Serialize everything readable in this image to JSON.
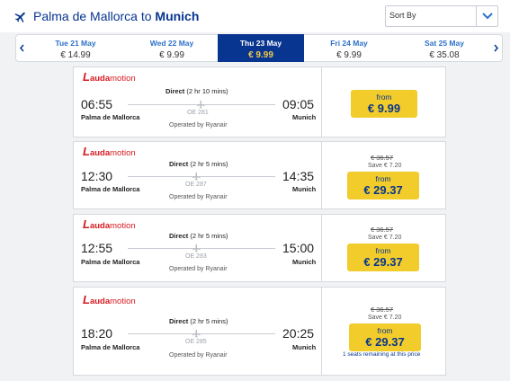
{
  "header": {
    "origin_text": "Palma de Mallorca to ",
    "destination_text": "Munich",
    "sort_label": "Sort By"
  },
  "dates": [
    {
      "day": "Tue 21 May",
      "price": "€ 14.99",
      "active": false
    },
    {
      "day": "Wed 22 May",
      "price": "€ 9.99",
      "active": false
    },
    {
      "day": "Thu 23 May",
      "price": "€ 9.99",
      "active": true
    },
    {
      "day": "Fri 24 May",
      "price": "€ 9.99",
      "active": false
    },
    {
      "day": "Sat 25 May",
      "price": "€ 35.08",
      "active": false
    }
  ],
  "flights": [
    {
      "airline_mark": "L",
      "airline_bold": "auda",
      "airline_rest": "motion",
      "dep_time": "06:55",
      "arr_time": "09:05",
      "dep_airport": "Palma de Mallorca",
      "arr_airport": "Munich",
      "direct_label": "Direct",
      "duration": "(2 hr 10 mins)",
      "flight_no": "OE 281",
      "operated": "Operated by Ryanair",
      "old_price": "",
      "save": "",
      "from": "from",
      "price": "€ 9.99",
      "seats": ""
    },
    {
      "airline_mark": "L",
      "airline_bold": "auda",
      "airline_rest": "motion",
      "dep_time": "12:30",
      "arr_time": "14:35",
      "dep_airport": "Palma de Mallorca",
      "arr_airport": "Munich",
      "direct_label": "Direct",
      "duration": "(2 hr 5 mins)",
      "flight_no": "OE 287",
      "operated": "Operated by Ryanair",
      "old_price": "€ 36.57",
      "save": "Save € 7.20",
      "from": "from",
      "price": "€ 29.37",
      "seats": ""
    },
    {
      "airline_mark": "L",
      "airline_bold": "auda",
      "airline_rest": "motion",
      "dep_time": "12:55",
      "arr_time": "15:00",
      "dep_airport": "Palma de Mallorca",
      "arr_airport": "Munich",
      "direct_label": "Direct",
      "duration": "(2 hr 5 mins)",
      "flight_no": "OE 283",
      "operated": "Operated by Ryanair",
      "old_price": "€ 36.57",
      "save": "Save € 7.20",
      "from": "from",
      "price": "€ 29.37",
      "seats": ""
    },
    {
      "airline_mark": "L",
      "airline_bold": "auda",
      "airline_rest": "motion",
      "dep_time": "18:20",
      "arr_time": "20:25",
      "dep_airport": "Palma de Mallorca",
      "arr_airport": "Munich",
      "direct_label": "Direct",
      "duration": "(2 hr 5 mins)",
      "flight_no": "OE 285",
      "operated": "Operated by Ryanair",
      "old_price": "€ 36.57",
      "save": "Save € 7.20",
      "from": "from",
      "price": "€ 29.37",
      "seats": "1 seats remaining at this price"
    }
  ],
  "colors": {
    "brand_navy": "#073590",
    "price_yellow": "#f2cc2a",
    "airline_red": "#d71921",
    "link_blue": "#2c71c8"
  }
}
